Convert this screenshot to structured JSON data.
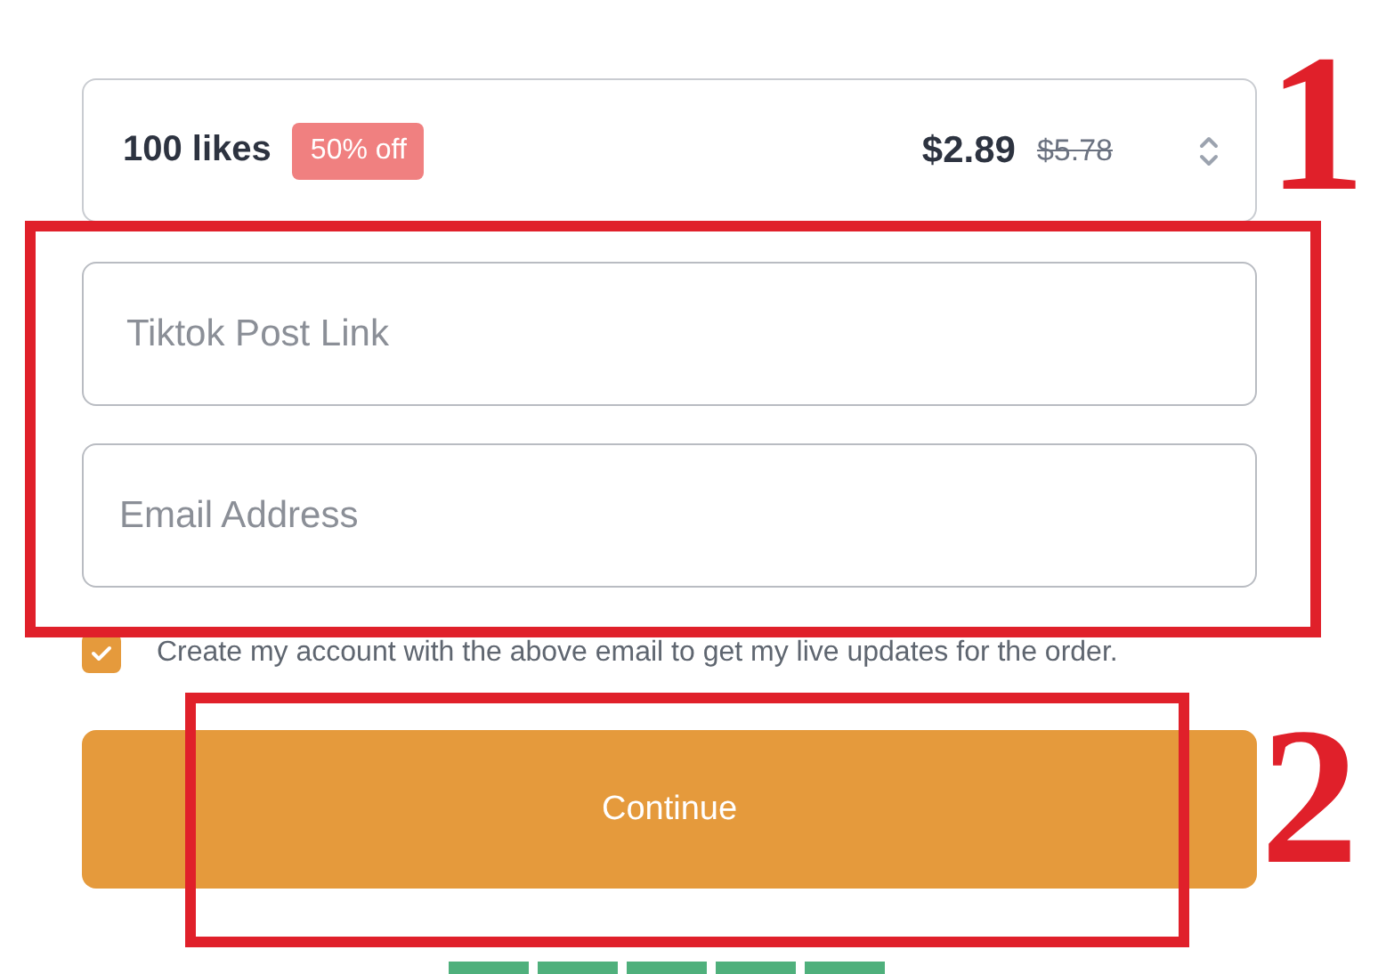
{
  "package": {
    "name": "100 likes",
    "discount": "50% off",
    "price": "$2.89",
    "old_price": "$5.78"
  },
  "fields": [
    {
      "placeholder": "Tiktok Post Link"
    },
    {
      "placeholder": "Email Address"
    }
  ],
  "account_option": {
    "label": "Create my account with the above email to get my live updates for the order.",
    "checked": true
  },
  "continue_button": "Continue",
  "rating": {
    "stars": 5
  },
  "annotations": [
    {
      "number": "1"
    },
    {
      "number": "2"
    }
  ]
}
